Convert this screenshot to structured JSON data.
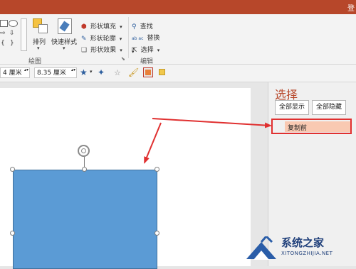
{
  "titlebar": {
    "text": "登",
    "color": "#b7472a"
  },
  "ribbon": {
    "arrange_label": "排列",
    "quick_styles_label": "快速样式",
    "shape_fill_label": "形状填充",
    "shape_outline_label": "形状轮廓",
    "shape_effects_label": "形状效果",
    "find_label": "查找",
    "replace_label": "替换",
    "select_label": "选择",
    "drawing_group_label": "绘图",
    "editing_group_label": "编辑",
    "replace_icon_text": "ab ac"
  },
  "size_fields": {
    "height_value": "4 厘米",
    "width_value": "8.35 厘米"
  },
  "selection_pane": {
    "title": "选择",
    "show_all_label": "全部显示",
    "hide_all_label": "全部隐藏",
    "items": [
      {
        "label": "复制前",
        "selected": true
      }
    ]
  },
  "watermark": {
    "title": "系统之家",
    "url": "XITONGZHIJIA.NET"
  },
  "colors": {
    "accent": "#b7472a",
    "shape_fill": "#5b9bd5",
    "annotation": "#e03030"
  }
}
